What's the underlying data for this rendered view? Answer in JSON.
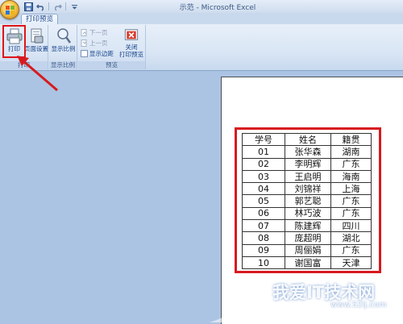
{
  "window": {
    "title": "示范 - Microsoft Excel"
  },
  "tabs": {
    "active": "打印预览"
  },
  "ribbon": {
    "buttons": {
      "print": "打印",
      "page_setup": "页面设置",
      "zoom": "显示比例",
      "close_preview_line1": "关闭",
      "close_preview_line2": "打印预览"
    },
    "small_buttons": {
      "next_page": "下一页",
      "prev_page": "上一页",
      "show_margins": "显示边距"
    },
    "groups": {
      "print": "打印",
      "zoom": "显示比例",
      "preview": "预览"
    }
  },
  "sheet": {
    "headers": [
      "学号",
      "姓名",
      "籍贯"
    ],
    "rows": [
      [
        "01",
        "张华森",
        "湖南"
      ],
      [
        "02",
        "李明辉",
        "广东"
      ],
      [
        "03",
        "王启明",
        "海南"
      ],
      [
        "04",
        "刘锦祥",
        "上海"
      ],
      [
        "05",
        "郭艺聪",
        "广东"
      ],
      [
        "06",
        "林巧波",
        "广东"
      ],
      [
        "07",
        "陈建辉",
        "四川"
      ],
      [
        "08",
        "庞超明",
        "湖北"
      ],
      [
        "09",
        "周俪娟",
        "广东"
      ],
      [
        "10",
        "谢国富",
        "天津"
      ]
    ]
  },
  "watermark": {
    "text": "我爱IT技术网",
    "url": "www.52ij.com"
  },
  "colors": {
    "annotation_red": "#d71a1f",
    "ribbon_text": "#15428b",
    "workspace_bg": "#abc4e3"
  }
}
